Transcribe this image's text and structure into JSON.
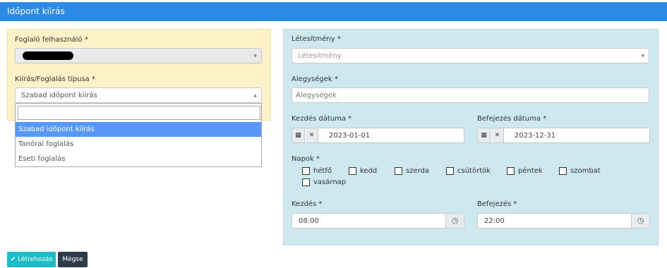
{
  "header": {
    "title": "Időpont kiírás"
  },
  "left": {
    "user_label": "Foglaló felhasználó *",
    "type_label": "Kiírás/Foglalás típusa *",
    "type_value": "Szabad időpont kiírás",
    "dropdown": {
      "search_value": "",
      "options": [
        "Szabad időpont kiírás",
        "Tanórai foglalás",
        "Eseti foglalás"
      ],
      "selected": 0
    }
  },
  "right": {
    "facility_label": "Létesítmény *",
    "facility_placeholder": "Létesítmény",
    "subunits_label": "Alegységek *",
    "subunits_placeholder": "Alegységek",
    "start_date_label": "Kezdés dátuma *",
    "start_date_value": "2023-01-01",
    "end_date_label": "Befejezés dátuma *",
    "end_date_value": "2023-12-31",
    "days_label": "Napok *",
    "days": [
      "hétfő",
      "kedd",
      "szerda",
      "csütörtök",
      "péntek",
      "szombat",
      "vasárnap"
    ],
    "start_time_label": "Kezdés *",
    "start_time_value": "08:00",
    "end_time_label": "Befejezés *",
    "end_time_value": "22:00"
  },
  "buttons": {
    "create": "Létrehozás",
    "cancel": "Mégse"
  },
  "icons": {
    "calendar": "calendar-icon",
    "clear": "clear-x-icon",
    "clock": "clock-icon",
    "check": "check-icon",
    "caret": "caret-icon"
  },
  "colors": {
    "header": "#2b8ae6",
    "left_panel": "#fdf1c8",
    "right_panel": "#cde8ee",
    "selected_option": "#5897fb",
    "primary_button": "#1ebcc8",
    "dark_button": "#2d3a4a"
  }
}
